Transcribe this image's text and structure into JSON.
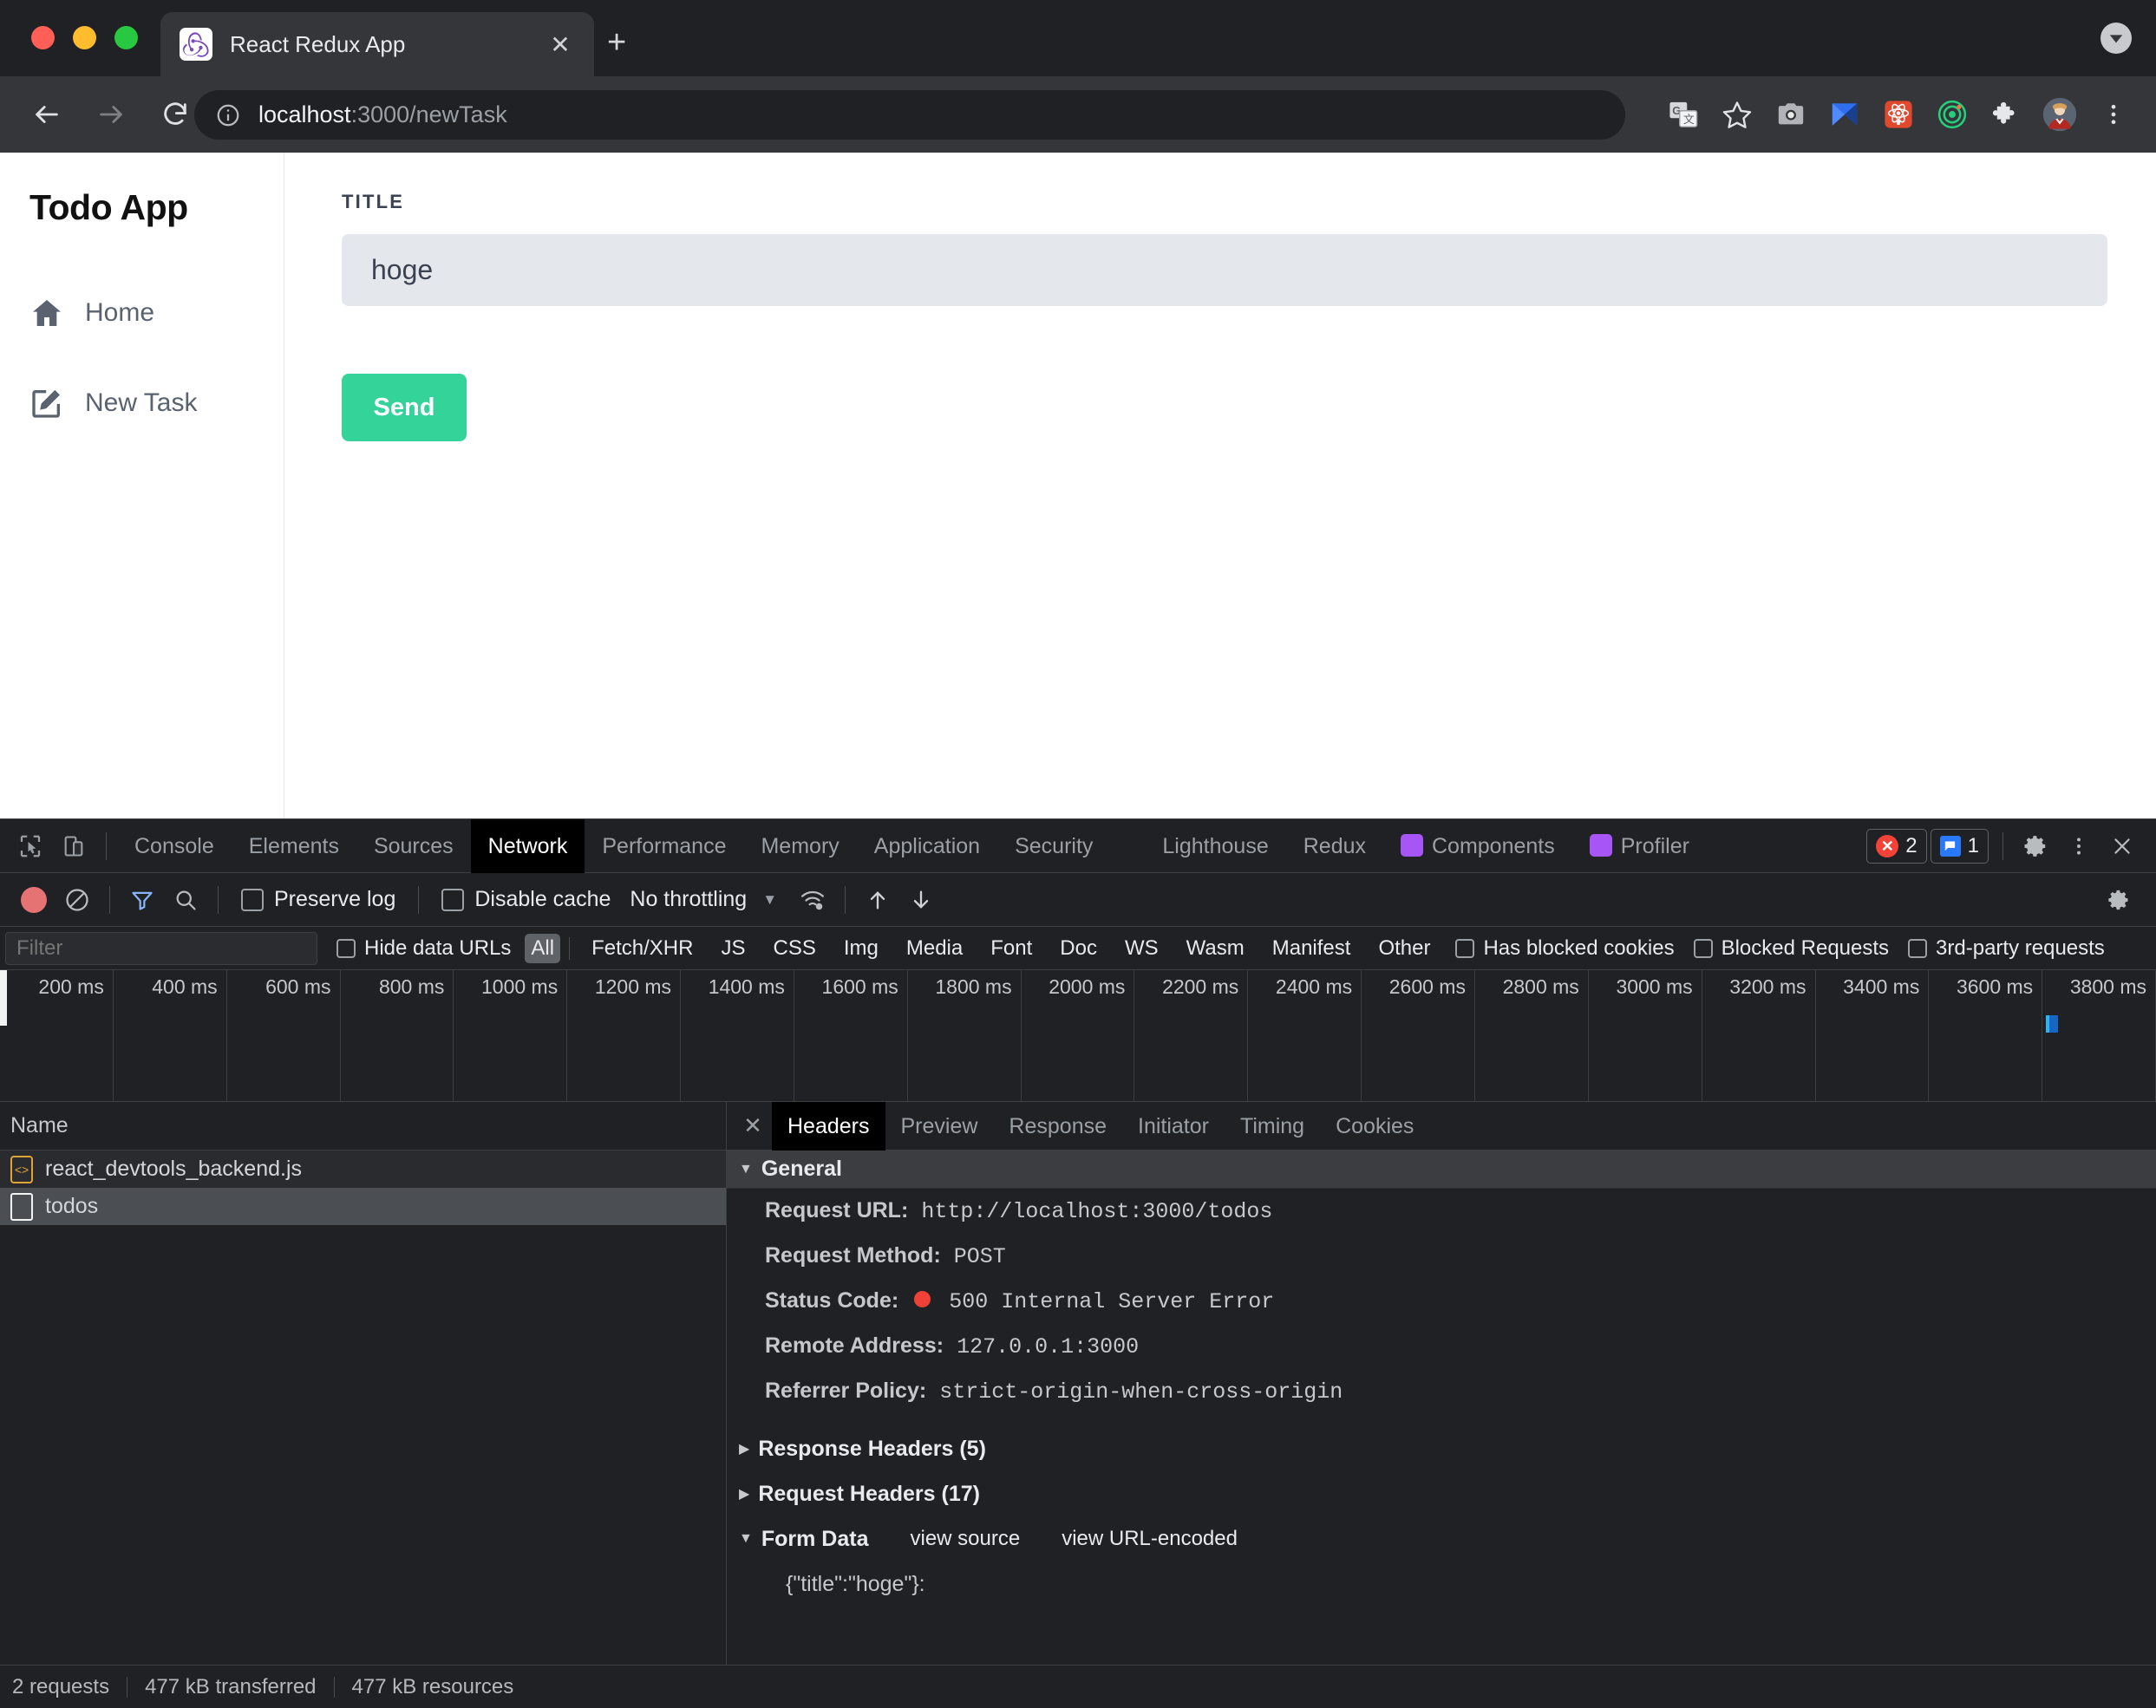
{
  "browser": {
    "tab_title": "React Redux App",
    "tab_close_label": "✕",
    "newtab_label": "+",
    "url_host": "localhost",
    "url_rest": ":3000/newTask",
    "toolbar_icons": [
      "translate-icon",
      "bookmark-star-icon",
      "camera-icon",
      "extension-blue-icon",
      "react-devtools-icon",
      "target-green-icon",
      "puzzle-icon",
      "avatar-icon",
      "chrome-menu-icon"
    ]
  },
  "app": {
    "title": "Todo App",
    "nav": [
      {
        "label": "Home",
        "icon": "home-icon"
      },
      {
        "label": "New Task",
        "icon": "edit-square-icon"
      }
    ],
    "form": {
      "label": "TITLE",
      "value": "hoge",
      "placeholder": "",
      "submit_label": "Send",
      "submit_color": "#34d399"
    }
  },
  "devtools": {
    "tabs": [
      {
        "label": "Console",
        "active": false
      },
      {
        "label": "Elements",
        "active": false
      },
      {
        "label": "Sources",
        "active": false
      },
      {
        "label": "Network",
        "active": true
      },
      {
        "label": "Performance",
        "active": false
      },
      {
        "label": "Memory",
        "active": false
      },
      {
        "label": "Application",
        "active": false
      },
      {
        "label": "Security",
        "active": false
      },
      {
        "label": "Lighthouse",
        "active": false
      },
      {
        "label": "Redux",
        "active": false
      },
      {
        "label": "Components",
        "active": false,
        "badge": "react"
      },
      {
        "label": "Profiler",
        "active": false,
        "badge": "react"
      }
    ],
    "error_count": "2",
    "message_count": "1",
    "netbar": {
      "preserve_log": "Preserve log",
      "disable_cache": "Disable cache",
      "throttling": "No throttling"
    },
    "filterbar": {
      "filter_placeholder": "Filter",
      "hide_data_urls": "Hide data URLs",
      "types": [
        {
          "label": "All",
          "active": true
        },
        {
          "label": "Fetch/XHR",
          "active": false
        },
        {
          "label": "JS",
          "active": false
        },
        {
          "label": "CSS",
          "active": false
        },
        {
          "label": "Img",
          "active": false
        },
        {
          "label": "Media",
          "active": false
        },
        {
          "label": "Font",
          "active": false
        },
        {
          "label": "Doc",
          "active": false
        },
        {
          "label": "WS",
          "active": false
        },
        {
          "label": "Wasm",
          "active": false
        },
        {
          "label": "Manifest",
          "active": false
        },
        {
          "label": "Other",
          "active": false
        }
      ],
      "checks": [
        "Has blocked cookies",
        "Blocked Requests",
        "3rd-party requests"
      ]
    },
    "timeline_ticks": [
      "200 ms",
      "400 ms",
      "600 ms",
      "800 ms",
      "1000 ms",
      "1200 ms",
      "1400 ms",
      "1600 ms",
      "1800 ms",
      "2000 ms",
      "2200 ms",
      "2400 ms",
      "2600 ms",
      "2800 ms",
      "3000 ms",
      "3200 ms",
      "3400 ms",
      "3600 ms",
      "3800 ms"
    ],
    "requests": {
      "column_name": "Name",
      "rows": [
        {
          "name": "react_devtools_backend.js",
          "icon": "js-file-icon",
          "selected": false
        },
        {
          "name": "todos",
          "icon": "doc-file-icon",
          "selected": true
        }
      ]
    },
    "detail": {
      "tabs": [
        {
          "label": "Headers",
          "active": true
        },
        {
          "label": "Preview",
          "active": false
        },
        {
          "label": "Response",
          "active": false
        },
        {
          "label": "Initiator",
          "active": false
        },
        {
          "label": "Timing",
          "active": false
        },
        {
          "label": "Cookies",
          "active": false
        }
      ],
      "general_title": "General",
      "general": [
        {
          "key": "Request URL:",
          "value": "http://localhost:3000/todos"
        },
        {
          "key": "Request Method:",
          "value": "POST"
        },
        {
          "key": "Status Code:",
          "value": "500 Internal Server Error",
          "status_dot": "#ef4136"
        },
        {
          "key": "Remote Address:",
          "value": "127.0.0.1:3000"
        },
        {
          "key": "Referrer Policy:",
          "value": "strict-origin-when-cross-origin"
        }
      ],
      "response_headers_title": "Response Headers (5)",
      "request_headers_title": "Request Headers (17)",
      "form_data_title": "Form Data",
      "form_data_links": [
        "view source",
        "view URL-encoded"
      ],
      "form_data_value": "{\"title\":\"hoge\"}:"
    },
    "status": [
      "2 requests",
      "477 kB transferred",
      "477 kB resources"
    ]
  }
}
